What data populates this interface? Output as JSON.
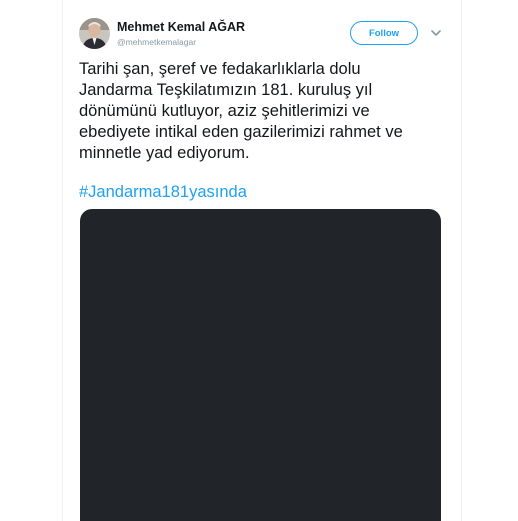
{
  "user": {
    "name": "Mehmet Kemal AĞAR",
    "handle": "@mehmetkemalagar",
    "avatar_icon": "user-avatar"
  },
  "follow_button": {
    "label": "Follow"
  },
  "menu_icon": "chevron-down-icon",
  "tweet": {
    "lines": [
      "Tarihi şan, şeref ve fedakarlıklarla dolu",
      "Jandarma Teşkilatımızın 181. kuruluş yıl",
      "dönümünü kutluyor, aziz şehitlerimizi ve",
      "ebediyete intikal eden gazilerimizi rahmet ve",
      "minnetle yad ediyorum."
    ],
    "hashtag": "#Jandarma181yasında"
  },
  "colors": {
    "accent": "#1da1f2",
    "text": "#14171a",
    "muted": "#8899a6",
    "media_background": "#212529"
  }
}
